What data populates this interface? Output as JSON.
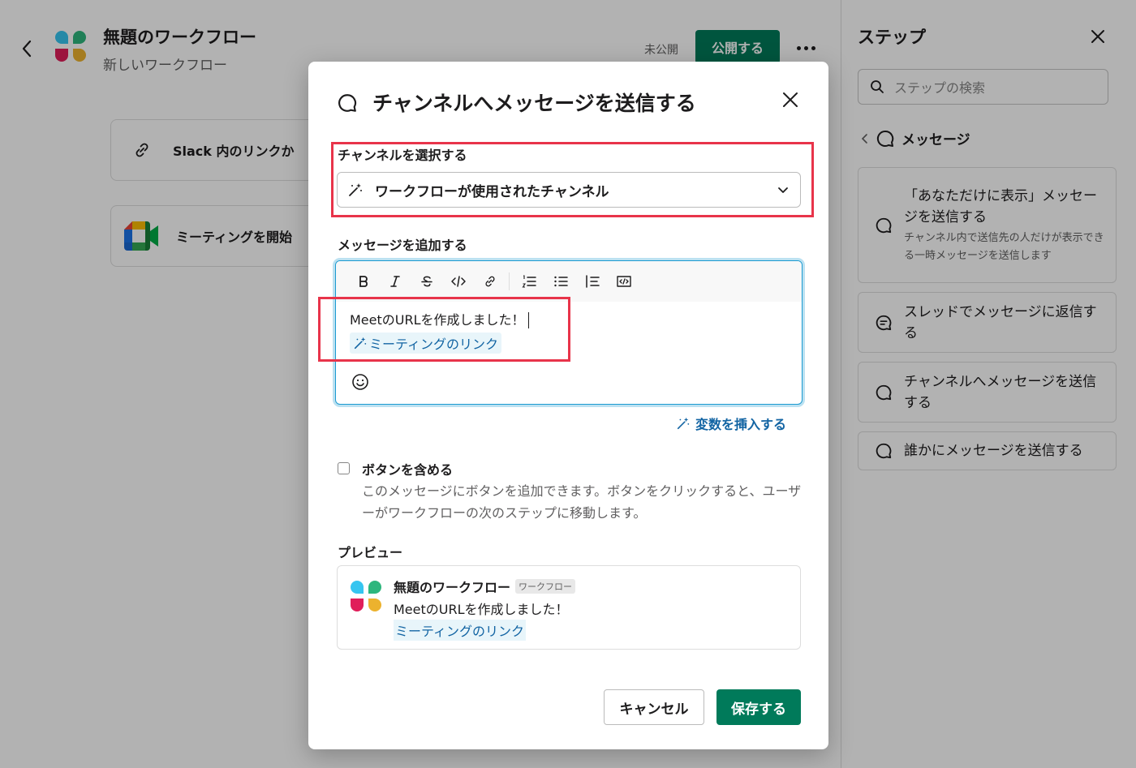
{
  "workflow": {
    "title": "無題のワークフロー",
    "subtitle": "新しいワークフロー",
    "status": "未公開",
    "publish_label": "公開する"
  },
  "canvas_steps": [
    {
      "label": "Slack 内のリンクか",
      "icon": "link-icon"
    },
    {
      "label": "ミーティングを開始",
      "icon": "google-meet-icon"
    }
  ],
  "sidebar": {
    "title": "ステップ",
    "search_placeholder": "ステップの検索",
    "breadcrumb": "メッセージ",
    "items": [
      {
        "title": "「あなただけに表示」メッセージを送信する",
        "description": "チャンネル内で送信先の人だけが表示できる一時メッセージを送信します",
        "icon": "message-icon"
      },
      {
        "title": "スレッドでメッセージに返信する",
        "description": "",
        "icon": "thread-icon"
      },
      {
        "title": "チャンネルへメッセージを送信する",
        "description": "",
        "icon": "message-icon"
      },
      {
        "title": "誰かにメッセージを送信する",
        "description": "",
        "icon": "message-icon"
      }
    ]
  },
  "modal": {
    "title": "チャンネルへメッセージを送信する",
    "channel_label": "チャンネルを選択する",
    "channel_value": "ワークフローが使用されたチャンネル",
    "message_label": "メッセージを追加する",
    "message_text": "MeetのURLを作成しました！",
    "variable_chip": "ミーティングのリンク",
    "insert_variable": "変数を挿入する",
    "checkbox_label": "ボタンを含める",
    "checkbox_checked": false,
    "checkbox_description": "このメッセージにボタンを追加できます。ボタンをクリックすると、ユーザーがワークフローの次のステップに移動します。",
    "preview_label": "プレビュー",
    "preview": {
      "name": "無題のワークフロー",
      "badge": "ワークフロー",
      "text": "MeetのURLを作成しました！",
      "link": "ミーティングのリンク"
    },
    "cancel_label": "キャンセル",
    "save_label": "保存する"
  },
  "colors": {
    "primary_green": "#007a5a",
    "link_blue": "#1264a3",
    "highlight_red": "#e8344a",
    "focus_blue": "#1d9bd1"
  }
}
